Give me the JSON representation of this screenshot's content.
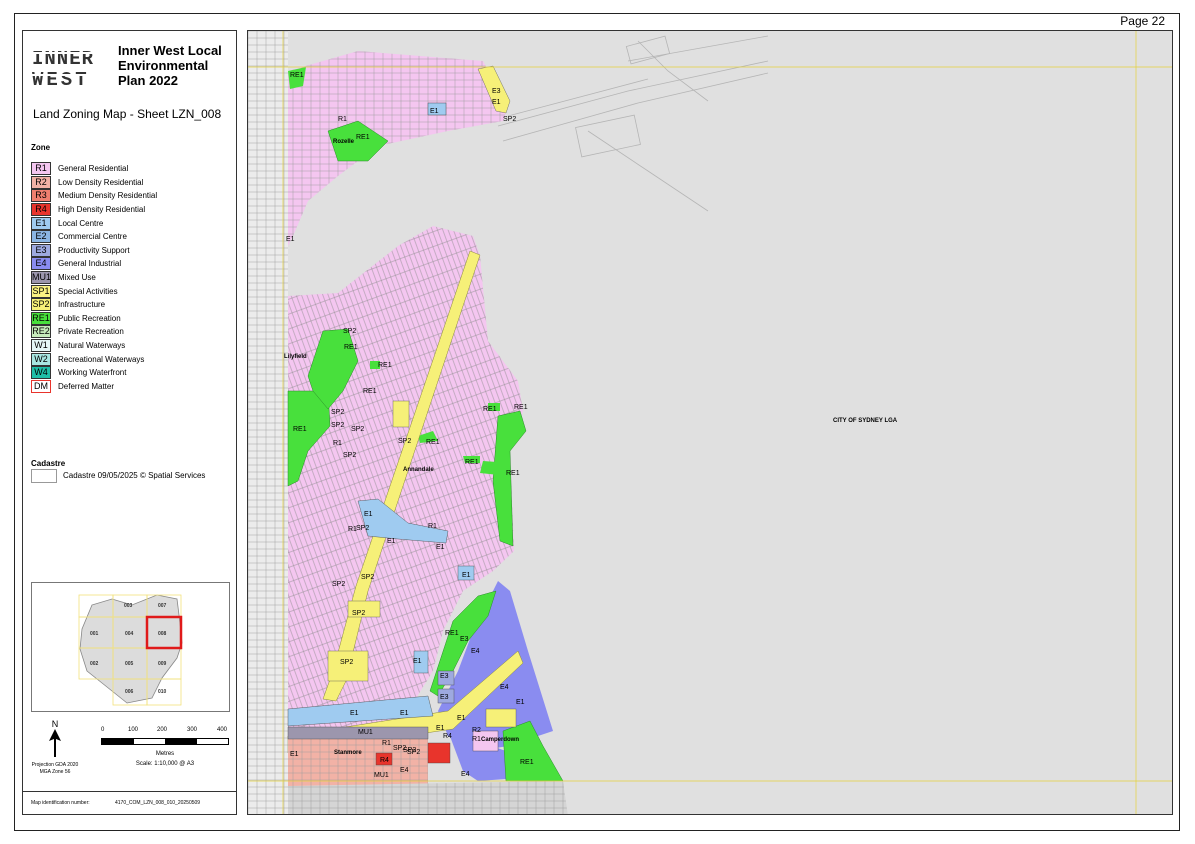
{
  "page": {
    "number_label": "Page 22"
  },
  "legend": {
    "logo_text": [
      "INNER",
      "WEST"
    ],
    "plan_title": "Inner West Local Environmental Plan 2022",
    "sheet_title": "Land Zoning Map - Sheet LZN_008",
    "zone_heading": "Zone",
    "zones": [
      {
        "code": "R1",
        "label": "General Residential",
        "color": "#f4c6f0"
      },
      {
        "code": "R2",
        "label": "Low Density Residential",
        "color": "#f2b2a6"
      },
      {
        "code": "R3",
        "label": "Medium Density Residential",
        "color": "#ef7f6f"
      },
      {
        "code": "R4",
        "label": "High Density Residential",
        "color": "#e8342c"
      },
      {
        "code": "E1",
        "label": "Local Centre",
        "color": "#9fcbf0"
      },
      {
        "code": "E2",
        "label": "Commercial Centre",
        "color": "#8bb5e3"
      },
      {
        "code": "E3",
        "label": "Productivity Support",
        "color": "#9ea9df"
      },
      {
        "code": "E4",
        "label": "General Industrial",
        "color": "#8a8cf0"
      },
      {
        "code": "MU1",
        "label": "Mixed Use",
        "color": "#9c96ad"
      },
      {
        "code": "SP1",
        "label": "Special Activities",
        "color": "#faf283"
      },
      {
        "code": "SP2",
        "label": "Infrastructure",
        "color": "#f6f078"
      },
      {
        "code": "RE1",
        "label": "Public Recreation",
        "color": "#48e03c"
      },
      {
        "code": "RE2",
        "label": "Private Recreation",
        "color": "#c7ebbb"
      },
      {
        "code": "W1",
        "label": "Natural Waterways",
        "color": "#e5f7f7"
      },
      {
        "code": "W2",
        "label": "Recreational Waterways",
        "color": "#a8e6e1"
      },
      {
        "code": "W4",
        "label": "Working Waterfront",
        "color": "#1fbfa8"
      },
      {
        "code": "DM",
        "label": "Deferred Matter",
        "color": "#ffffff"
      }
    ],
    "cadastre_heading": "Cadastre",
    "cadastre_label": "Cadastre 09/05/2025 © Spatial Services",
    "north_label": "N",
    "projection": [
      "Projection GDA 2020",
      "MGA Zone 56"
    ],
    "scale_ticks": [
      "0",
      "100",
      "200",
      "300",
      "400"
    ],
    "scale_unit": "Metres",
    "scale_text": "Scale: 1:10,000 @ A3",
    "map_id_label": "Map identification number:",
    "map_id_value": "4170_COM_LZN_008_010_20250509"
  },
  "keymap": {
    "sheets": [
      "001",
      "002",
      "003",
      "004",
      "005",
      "006",
      "007",
      "008",
      "009",
      "010"
    ],
    "highlight": "008"
  },
  "map": {
    "lga_label": "CITY OF SYDNEY LGA",
    "suburbs": [
      "Rozelle",
      "Lilyfield",
      "Annandale",
      "Stanmore",
      "Camperdown"
    ],
    "zone_labels": [
      "RE1",
      "R1",
      "RE1",
      "E1",
      "E3",
      "E1",
      "SP2",
      "E1",
      "RE1",
      "SP2",
      "RE1",
      "RE1",
      "SP2",
      "SP2",
      "R1",
      "RE1",
      "SP2",
      "SP2",
      "RE1",
      "RE1",
      "R1",
      "RE1",
      "RE1",
      "SP2",
      "RE1",
      "E1",
      "SP2",
      "R1",
      "E1",
      "E1",
      "E1",
      "SP2",
      "SP2",
      "E1",
      "SP2",
      "SP2",
      "RE1",
      "E3",
      "E4",
      "SP2",
      "E1",
      "E3",
      "E3",
      "E4",
      "E1",
      "E1",
      "E1",
      "MU1",
      "E1",
      "E1",
      "SP2",
      "R2",
      "R1",
      "R4",
      "R1",
      "R4",
      "SP2",
      "MU1",
      "E4",
      "E4",
      "RE1"
    ]
  }
}
